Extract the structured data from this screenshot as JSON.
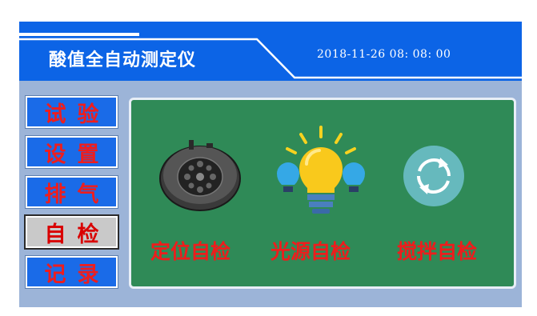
{
  "header": {
    "title": "酸值全自动测定仪",
    "datetime": "2018-11-26 08: 08: 00"
  },
  "menu": [
    {
      "label": "试验",
      "active": false
    },
    {
      "label": "设置",
      "active": false
    },
    {
      "label": "排气",
      "active": false
    },
    {
      "label": "自检",
      "active": true
    },
    {
      "label": "记录",
      "active": false
    }
  ],
  "panel": {
    "items": [
      {
        "label": "定位自检",
        "icon": "turntable-icon"
      },
      {
        "label": "光源自检",
        "icon": "light-bulb-icon"
      },
      {
        "label": "搅拌自检",
        "icon": "rotate-arrows-icon"
      }
    ]
  },
  "colors": {
    "header_blue": "#0c64e6",
    "screen_bg": "#9cb4d8",
    "panel_green": "#2f8a57",
    "label_red": "#ef1c1c"
  }
}
